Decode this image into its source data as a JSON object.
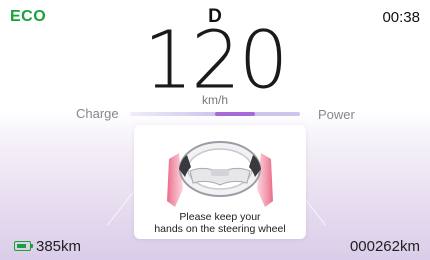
{
  "status": {
    "drive_mode": "ECO",
    "gear": "D",
    "time": "00:38"
  },
  "speed": {
    "value": "120",
    "unit": "km/h"
  },
  "power_meter": {
    "left_label": "Charge",
    "right_label": "Power",
    "power_fraction": 0.47
  },
  "alert": {
    "icon": "steering-wheel-hands-icon",
    "message_line1": "Please keep your",
    "message_line2": "hands on the steering wheel"
  },
  "footer": {
    "battery_icon": "battery-icon",
    "battery_fraction": 0.85,
    "range": "385km",
    "odometer": "000262km"
  },
  "colors": {
    "eco_green": "#18a33a",
    "power_fill": "#a56ad6",
    "alert_hands": "#e85a7a"
  }
}
